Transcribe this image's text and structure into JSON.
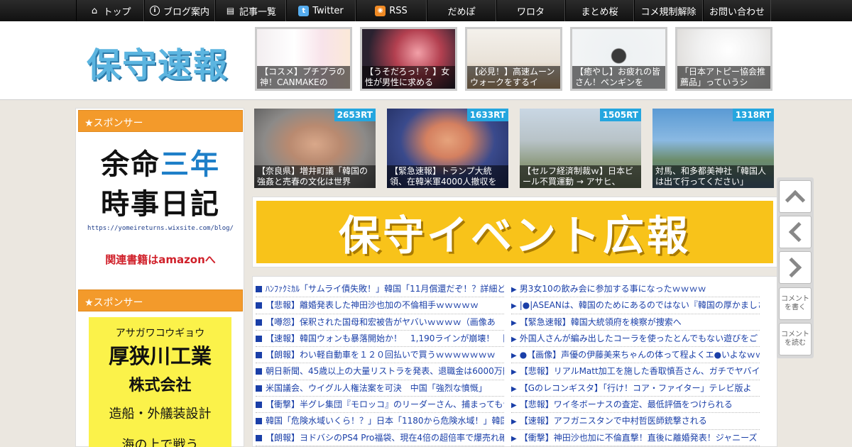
{
  "nav": [
    {
      "label": "トップ",
      "icon": "home-icon"
    },
    {
      "label": "ブログ案内",
      "icon": "info-icon"
    },
    {
      "label": "記事一覧",
      "icon": "list-icon"
    },
    {
      "label": "Twitter",
      "icon": "twitter-icon"
    },
    {
      "label": "RSS",
      "icon": "rss-icon"
    },
    {
      "label": "だめぽ",
      "icon": ""
    },
    {
      "label": "ワロタ",
      "icon": ""
    },
    {
      "label": "まとめ桜",
      "icon": ""
    },
    {
      "label": "コメ規制解除",
      "icon": ""
    },
    {
      "label": "お問い合わせ",
      "icon": ""
    }
  ],
  "logo": "保守速報",
  "header_thumbs": [
    {
      "caption": "【コスメ】プチプラの神！CANMAKEの"
    },
    {
      "caption": "【うそだろっ！？】女性が男性に求める"
    },
    {
      "caption": "【必見！】高速ムーンウォークをするイ"
    },
    {
      "caption": "【癒やし】お疲れの皆さん！ペンギンを"
    },
    {
      "caption": "「日本アトピー協会推薦品」っていうシ"
    }
  ],
  "sidebar": {
    "sponsor1_title": "★スポンサー",
    "ad1": {
      "line1a": "余命",
      "line1b": "三年",
      "line2": "時事日記",
      "url": "https://yomeireturns.wixsite.com/blog/",
      "amazon": "関連書籍はamazonへ"
    },
    "sponsor2_title": "★スポンサー",
    "ad2": {
      "kana": "アサガワコウギョウ",
      "company": "厚狭川工業",
      "kk": "株式会社",
      "business": "造船・外艤装設計",
      "more": "海の上で戦う"
    }
  },
  "ranking_cards": [
    {
      "rt": "2653RT",
      "caption": "【奈良県】増井町議「韓国の強姦と売春の文化は世界"
    },
    {
      "rt": "1633RT",
      "caption": "【緊急速報】トランプ大統領、在韓米軍4000人撤収を"
    },
    {
      "rt": "1505RT",
      "caption": "【セルフ経済制裁ｗ】日本ビール不買運動 → アサヒ、"
    },
    {
      "rt": "1318RT",
      "caption": "対馬、和多都美神社「韓国人は出て行ってください」"
    }
  ],
  "banner": "保守イベント広報",
  "list_left": [
    "ﾊﾝﾌｧｸﾐｶﾙ「サムライ債失敗！」韓国「11月償還だぞ！？詳細ど",
    "【悲報】離婚発表した神田沙也加の不倫相手ｗｗｗｗｗ",
    "【噂怨】保釈された国母和宏被告がヤバいｗｗｗｗ（画像あ",
    "【速報】韓国ウォンも暴落開始か！　1,190ラインが崩壊！　阿",
    "【朗報】わい軽自動車を１２０回払いで買うｗｗｗｗｗｗｗ",
    "朝日新聞、45歳以上の大量リストラを発表、退職金は6000万円",
    "米国議会、ウイグル人権法案を可決　中国「強烈な憤慨」",
    "【衝撃】半グレ集団『モロッコ』のリーダーさん、捕まってもｗ",
    "韓国「危険水域いくら！？」日本「1180から危険水域！」韓国",
    "【朗報】ヨドバシのPS4 Pro福袋、現在4倍の超倍率で爆売れ確"
  ],
  "list_right": [
    "男3女10の飲み会に参加する事になったｗｗｗｗ",
    "|●|ASEANは、韓国のためにあるのではない『韓国の厚かましさ",
    "【緊急速報】韓国大統領府を検察が捜索へ",
    "外国人さんが編み出したコーラを使ったとんでもない遊びをご",
    "●【画像】声優の伊藤美来ちゃんの体って程よくエ●いよなｗｗ",
    "【悲報】リアルMatt加工を施した香取慎吾さん、ガチでヤバイ",
    "【Gのレコンギスタ】「行け！コア・ファイター」テレビ版よ",
    "【悲報】ワイ冬ボーナスの査定、最低評価をつけられる",
    "【速報】アフガニスタンで中村哲医師銃撃される",
    "【衝撃】神田沙也加に不倫直撃！直後に離婚発表！ジャニーズ"
  ],
  "side_controls": {
    "comment_write": "コメントを書く",
    "comment_read": "コメントを読む"
  }
}
